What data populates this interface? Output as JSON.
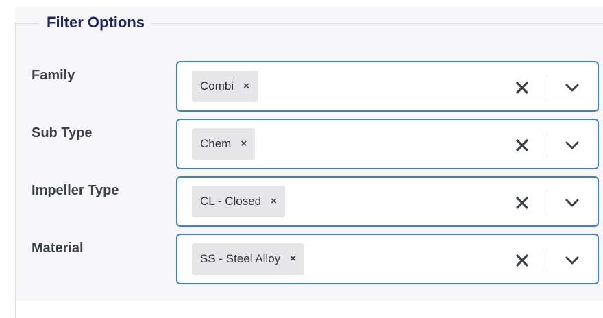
{
  "filter_panel": {
    "legend": "Filter Options",
    "rows": [
      {
        "label": "Family",
        "selected": [
          {
            "text": "Combi"
          }
        ]
      },
      {
        "label": "Sub Type",
        "selected": [
          {
            "text": "Chem"
          }
        ]
      },
      {
        "label": "Impeller Type",
        "selected": [
          {
            "text": "CL - Closed"
          }
        ]
      },
      {
        "label": "Material",
        "selected": [
          {
            "text": "SS - Steel Alloy"
          }
        ]
      }
    ]
  },
  "icons": {
    "chip_remove": "×",
    "clear": "x-icon",
    "dropdown": "chevron-down-icon"
  },
  "colors": {
    "accent_border": "#3b7ee3",
    "legend_text": "#20255e",
    "label_text": "#3d4248",
    "chip_background": "#e6e6e8",
    "panel_background": "#f7f7f9"
  }
}
